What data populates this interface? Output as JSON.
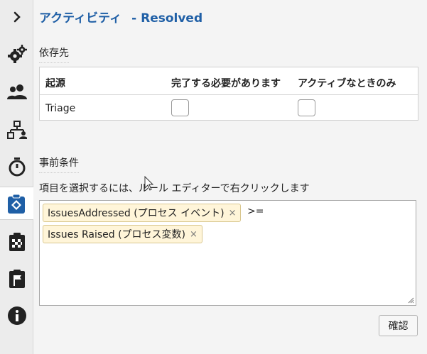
{
  "rail": {
    "items": [
      {
        "name": "expand-chevron-icon"
      },
      {
        "name": "gears-icon"
      },
      {
        "name": "users-icon"
      },
      {
        "name": "org-chart-icon"
      },
      {
        "name": "timer-icon"
      },
      {
        "name": "clipboard-diamond-icon"
      },
      {
        "name": "clipboard-checker-icon"
      },
      {
        "name": "flag-icon"
      },
      {
        "name": "info-icon"
      }
    ]
  },
  "header": {
    "title_prefix": "アクティビティ",
    "title_suffix": "- Resolved"
  },
  "dependencies": {
    "label": "依存先",
    "columns": [
      "起源",
      "完了する必要があります",
      "アクティブなときのみ"
    ],
    "rows": [
      {
        "origin": "Triage",
        "must_complete": false,
        "only_when_active": false
      }
    ]
  },
  "preconditions": {
    "label": "事前条件",
    "hint": "項目を選択するには、ルール エディターで右クリックします",
    "chips": [
      {
        "text": "IssuesAddressed (プロセス イベント)",
        "remove": "×"
      },
      {
        "text": "Issues Raised (プロセス変数)",
        "remove": "×"
      }
    ],
    "operator": ">="
  },
  "actions": {
    "confirm_label": "確認"
  }
}
